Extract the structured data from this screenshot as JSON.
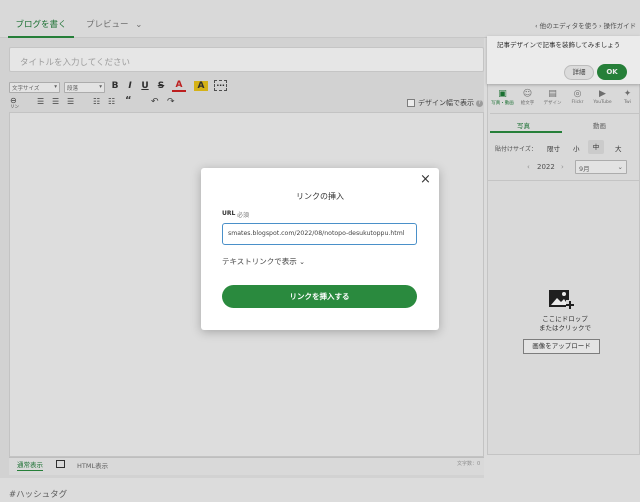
{
  "tabs": {
    "write": "ブログを書く",
    "preview": "プレビュー"
  },
  "top_links": {
    "other_editor": "他のエディタを使う",
    "guide": "操作ガイド"
  },
  "editor": {
    "title_placeholder": "タイトルを入力してください",
    "font_size": "文字サイズ",
    "paragraph": "段落",
    "link_label": "リンク",
    "design_width": "デザイン幅で表示",
    "mode_normal": "通常表示",
    "mode_html": "HTML表示",
    "char_count": "文字数：0",
    "hashtag": "#ハッシュタグ"
  },
  "banner": {
    "text": "記事デザインで記事を装飾してみましょう",
    "detail": "詳細",
    "ok": "OK"
  },
  "side": {
    "icons": [
      {
        "label": "写真・動画",
        "icon": "photo-icon"
      },
      {
        "label": "絵文字",
        "icon": "emoji-icon"
      },
      {
        "label": "デザイン",
        "icon": "design-icon"
      },
      {
        "label": "Flickr",
        "icon": "flickr-icon"
      },
      {
        "label": "YouTube",
        "icon": "youtube-icon"
      },
      {
        "label": "Twi",
        "icon": "twitter-icon"
      }
    ],
    "subtabs": {
      "photo": "写真",
      "video": "動画"
    },
    "paste_size": "貼付けサイズ：",
    "sizes": [
      "限寸",
      "小",
      "中",
      "大"
    ],
    "year": "2022",
    "month": "9月",
    "drop_line1": "ここにドロップ",
    "drop_line2": "またはクリックで",
    "upload": "画像をアップロード"
  },
  "modal": {
    "title": "リンクの挿入",
    "url_label": "URL",
    "required": "必須",
    "url_value": "smates.blogspot.com/2022/08/notopo-desukutoppu.html",
    "text_link": "テキストリンクで表示",
    "insert": "リンクを挿入する"
  },
  "colors": {
    "accent": "#2a8a3e",
    "input_border": "#4a90c9"
  }
}
